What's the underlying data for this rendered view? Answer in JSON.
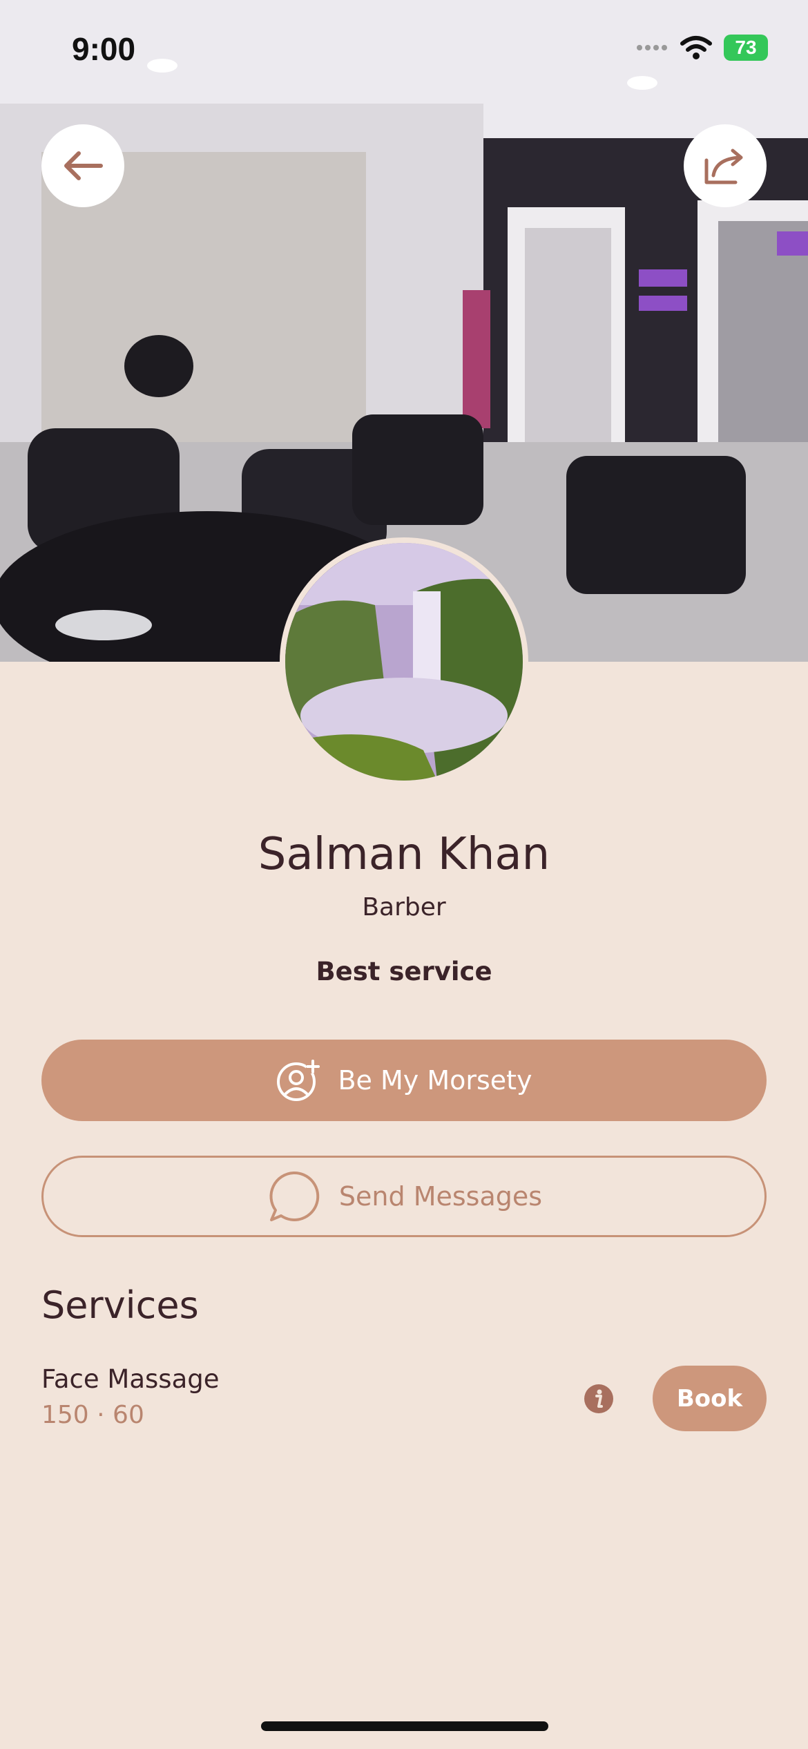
{
  "status_bar": {
    "time": "9:00",
    "battery": "73"
  },
  "profile": {
    "name": "Salman Khan",
    "role": "Barber",
    "tagline": "Best service"
  },
  "actions": {
    "primary_label": "Be My Morsety",
    "secondary_label": "Send Messages"
  },
  "services": {
    "title": "Services",
    "items": [
      {
        "name": "Face Massage",
        "meta": "150 · 60",
        "book_label": "Book"
      }
    ]
  },
  "colors": {
    "background": "#f2e4da",
    "accent": "#cd977c",
    "text": "#3b2329",
    "muted": "#b9856f"
  },
  "icons": [
    "back-arrow-icon",
    "share-icon",
    "wifi-icon",
    "add-user-icon",
    "chat-bubble-icon",
    "info-icon"
  ]
}
